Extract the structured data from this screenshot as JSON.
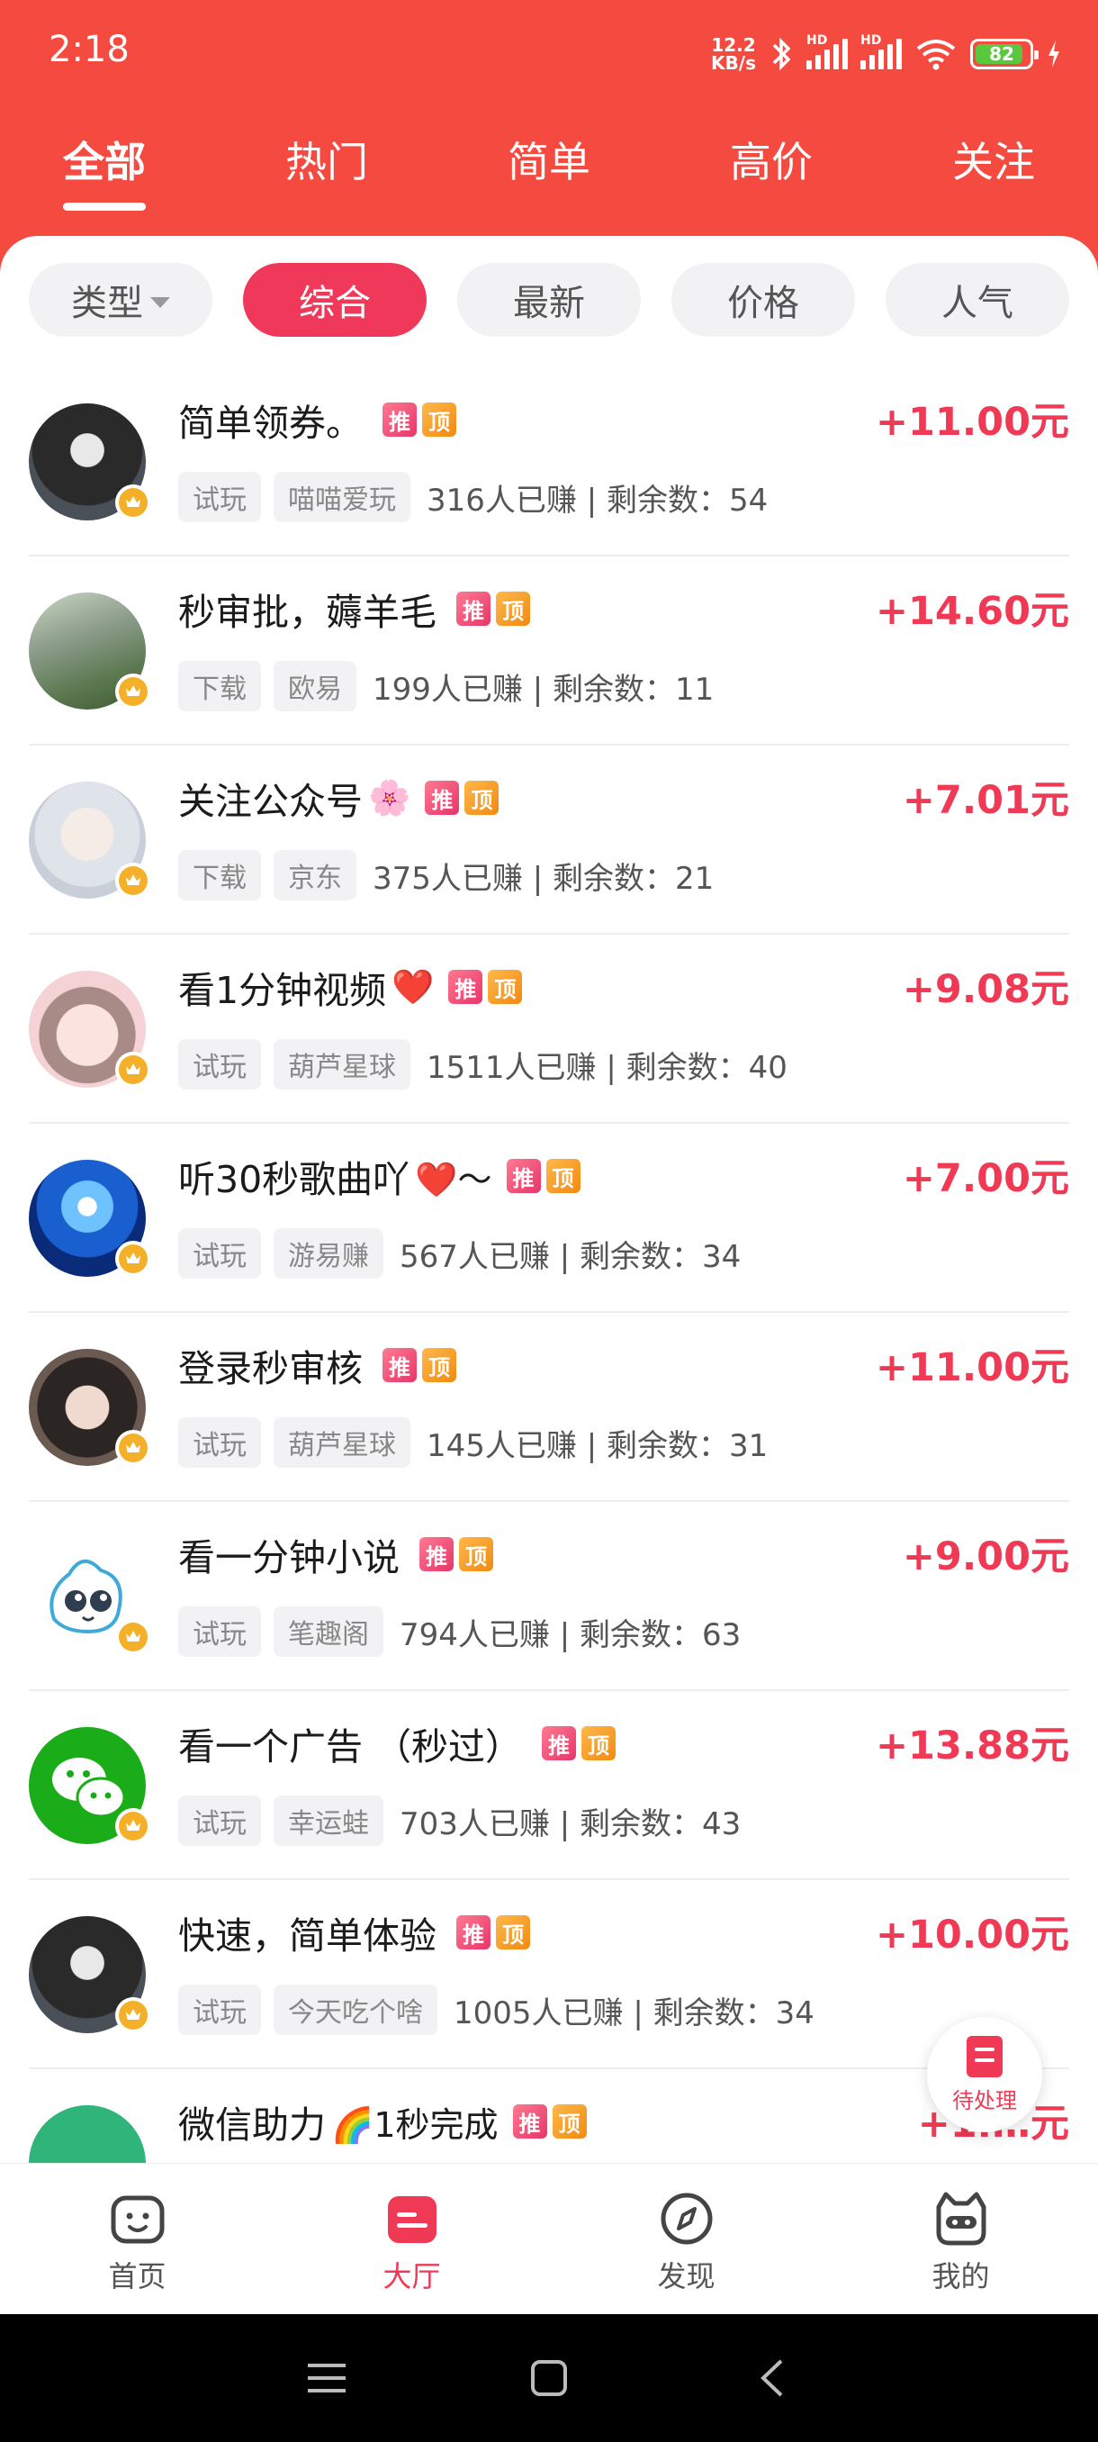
{
  "status_bar": {
    "time": "2:18",
    "net_speed_value": "12.2",
    "net_speed_unit": "KB/s",
    "signal_label": "HD",
    "battery": "82"
  },
  "top_tabs": [
    "全部",
    "热门",
    "简单",
    "高价",
    "关注"
  ],
  "filters": [
    "类型",
    "综合",
    "最新",
    "价格",
    "人气"
  ],
  "badges": {
    "recommend": "推",
    "top": "顶"
  },
  "tasks": [
    {
      "title": "简单领券。",
      "emoji": "",
      "price": "+11.00元",
      "tag1": "试玩",
      "tag2": "喵喵爱玩",
      "stats": "316人已赚 | 剩余数：54"
    },
    {
      "title": "秒审批，薅羊毛",
      "emoji": "",
      "price": "+14.60元",
      "tag1": "下载",
      "tag2": "欧易",
      "stats": "199人已赚 | 剩余数：11"
    },
    {
      "title": "关注公众号",
      "emoji": "🌸",
      "price": "+7.01元",
      "tag1": "下载",
      "tag2": "京东",
      "stats": "375人已赚 | 剩余数：21"
    },
    {
      "title": "看1分钟视频",
      "emoji": "❤️",
      "price": "+9.08元",
      "tag1": "试玩",
      "tag2": "葫芦星球",
      "stats": "1511人已赚 | 剩余数：40"
    },
    {
      "title": "听30秒歌曲吖",
      "emoji": "❤️～",
      "price": "+7.00元",
      "tag1": "试玩",
      "tag2": "游易赚",
      "stats": "567人已赚 | 剩余数：34"
    },
    {
      "title": "登录秒审核",
      "emoji": "",
      "price": "+11.00元",
      "tag1": "试玩",
      "tag2": "葫芦星球",
      "stats": "145人已赚 | 剩余数：31"
    },
    {
      "title": "看一分钟小说",
      "emoji": "",
      "price": "+9.00元",
      "tag1": "试玩",
      "tag2": "笔趣阁",
      "stats": "794人已赚 | 剩余数：63"
    },
    {
      "title": "看一个广告 （秒过）",
      "emoji": "",
      "price": "+13.88元",
      "tag1": "试玩",
      "tag2": "幸运蛙",
      "stats": "703人已赚 | 剩余数：43"
    },
    {
      "title": "快速，简单体验",
      "emoji": "",
      "price": "+10.00元",
      "tag1": "试玩",
      "tag2": "今天吃个啥",
      "stats": "1005人已赚 | 剩余数：34"
    },
    {
      "title": "微信助力",
      "emoji": "🌈1秒完成",
      "price": "+1.…元",
      "tag1": "",
      "tag2": "",
      "stats": ""
    }
  ],
  "fab_label": "待处理",
  "bottom_nav": [
    "首页",
    "大厅",
    "发现",
    "我的"
  ],
  "colors": {
    "header": "#f44a40",
    "accent": "#f03a55",
    "vip": "#f5b02a"
  }
}
